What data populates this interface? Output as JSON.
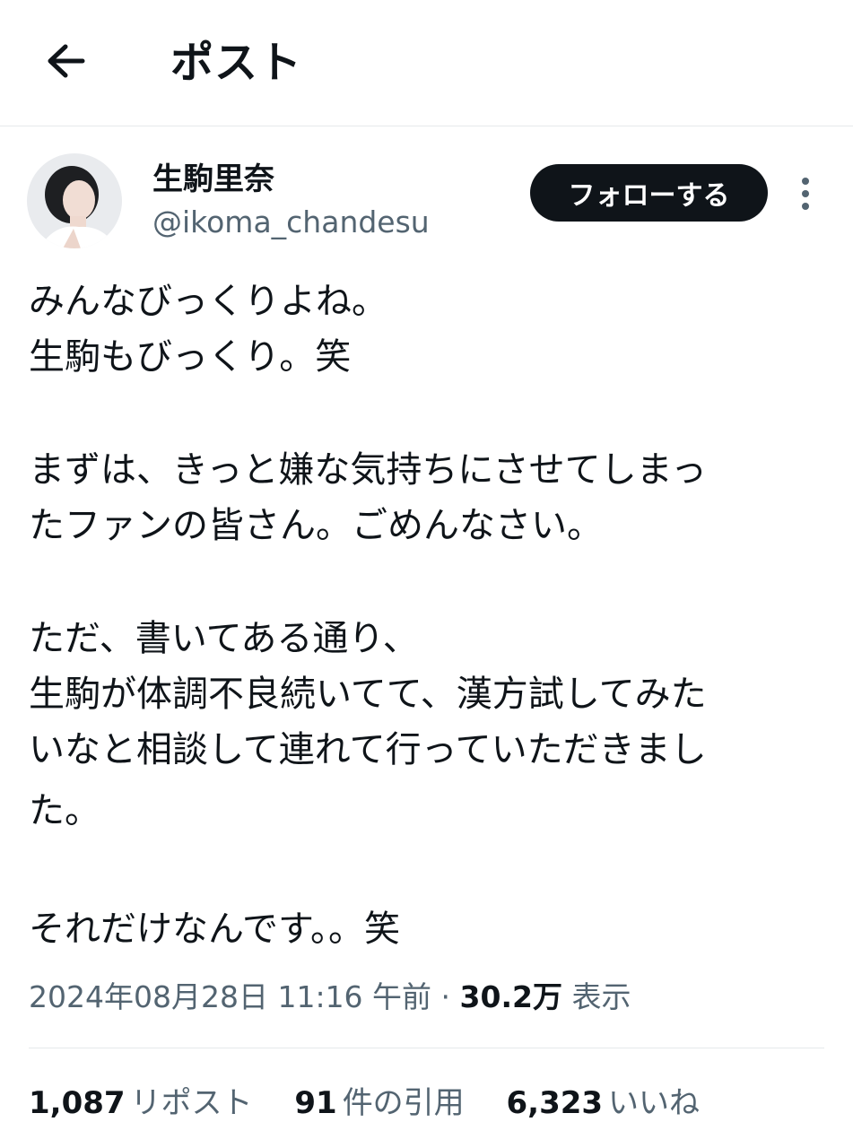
{
  "header": {
    "title": "ポスト",
    "back_icon": "arrow-left-icon"
  },
  "author": {
    "display_name": "生駒里奈",
    "handle": "@ikoma_chandesu",
    "follow_label": "フォローする",
    "more_icon": "vertical-dots-icon"
  },
  "tweet": {
    "lines": [
      "みんなびっくりよね。",
      "生駒もびっくり。笑",
      "",
      "まずは、きっと嫌な気持ちにさせてしまっ",
      "たファンの皆さん。ごめんなさい。",
      "",
      "ただ、書いてある通り、",
      "生駒が体調不良続いてて、漢方試してみた",
      "いなと相談して連れて行っていただきまし",
      "た。",
      "",
      "それだけなんです。。笑"
    ]
  },
  "meta": {
    "timestamp": "2024年08月28日 11:16 午前",
    "separator": "·",
    "views_count": "30.2万",
    "views_label": "表示"
  },
  "stats": [
    {
      "count": "1,087",
      "label": "リポスト"
    },
    {
      "count": "91",
      "label": "件の引用"
    },
    {
      "count": "6,323",
      "label": "いいね"
    }
  ],
  "colors": {
    "text": "#0f1419",
    "secondary": "#536471",
    "divider": "#e6e9eb",
    "button_bg": "#0f1419"
  }
}
